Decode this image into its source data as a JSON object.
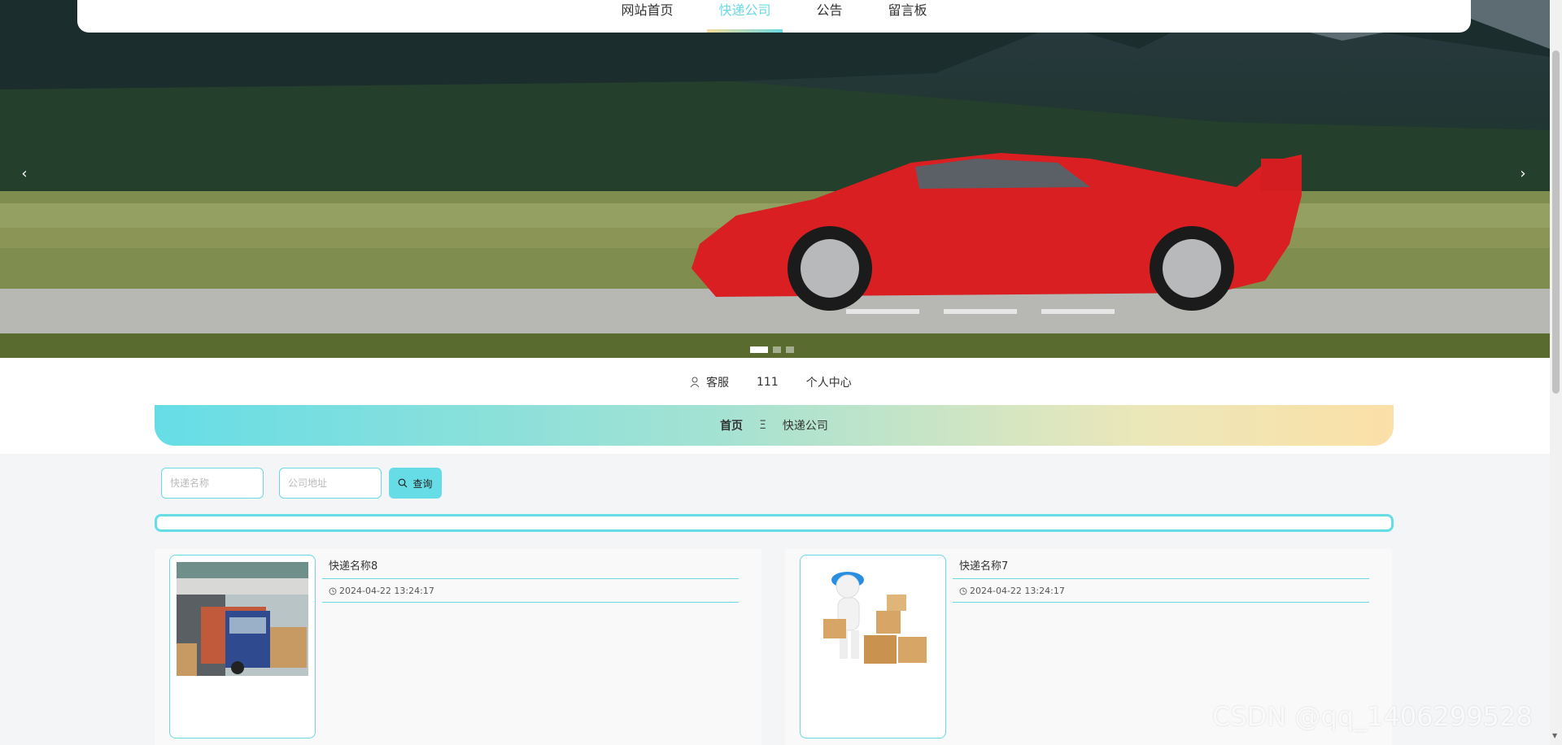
{
  "nav": {
    "items": [
      {
        "label": "网站首页"
      },
      {
        "label": "快递公司"
      },
      {
        "label": "公告"
      },
      {
        "label": "留言板"
      }
    ]
  },
  "banner": {
    "prev_icon": "chevron-left-icon",
    "next_icon": "chevron-right-icon",
    "slides": 3,
    "active_slide": 1
  },
  "user": {
    "service_label": "客服",
    "username": "111",
    "center_label": "个人中心"
  },
  "breadcrumb": {
    "home": "首页",
    "separator": "Ξ",
    "current": "快递公司"
  },
  "search": {
    "name_placeholder": "快递名称",
    "address_placeholder": "公司地址",
    "button_label": "查询"
  },
  "cards": [
    {
      "title": "快递名称8",
      "date": "2024-04-22 13:24:17"
    },
    {
      "title": "快递名称7",
      "date": "2024-04-22 13:24:17"
    }
  ],
  "watermark": "CSDN @qq_1406299528",
  "colors": {
    "accent": "#66dde6",
    "accent_warm": "#fbe0a7"
  }
}
